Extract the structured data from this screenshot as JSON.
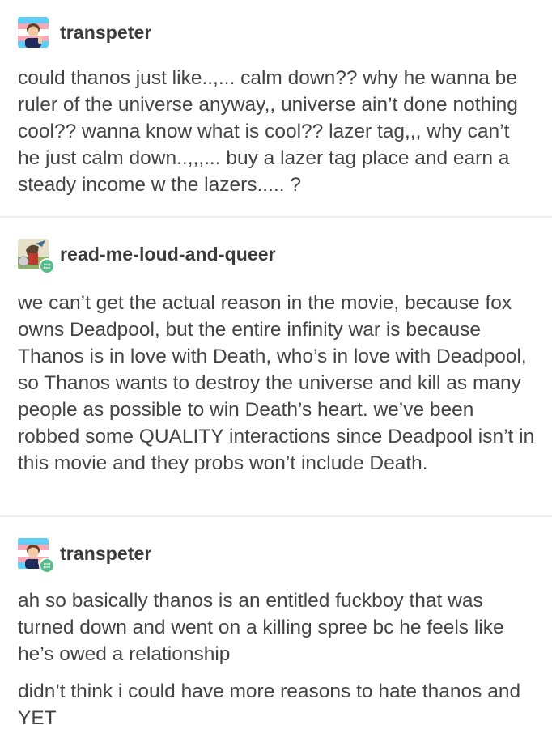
{
  "posts": [
    {
      "username": "transpeter",
      "avatar_icon": "avatar-transpeter-icon",
      "reblog": false,
      "paragraphs": [
        "could thanos just like..,... calm down?? why he wanna be ruler of the universe anyway,, universe ain’t done nothing cool?? wanna know what is cool?? lazer tag,,, why can’t he just calm down..,,,... buy a lazer tag place and earn a steady income w the lazers..... ?"
      ]
    },
    {
      "username": "read-me-loud-and-queer",
      "avatar_icon": "avatar-read-me-loud-and-queer-icon",
      "reblog": true,
      "paragraphs": [
        "we can’t get the actual reason in the movie, because fox owns Deadpool, but the entire infinity war is because Thanos is in love with Death, who’s in love with Deadpool, so Thanos wants to destroy the universe and kill as many people as possible to win Death’s heart. we’ve been robbed some QUALITY interactions since Deadpool isn’t in this movie and they probs won’t include Death."
      ]
    },
    {
      "username": "transpeter",
      "avatar_icon": "avatar-transpeter-icon",
      "reblog": true,
      "paragraphs": [
        "ah so basically thanos is an entitled fuckboy that was turned down and went on a killing spree bc he feels like he’s owed a relationship",
        "didn’t think i could have more reasons to hate thanos and YET"
      ]
    }
  ],
  "colors": {
    "text": "#444444",
    "username": "#3b3b3b",
    "divider": "#ececec",
    "reblog_badge": "#56bc8a",
    "trans_blue": "#5bcefa",
    "trans_pink": "#f5a9b8"
  }
}
